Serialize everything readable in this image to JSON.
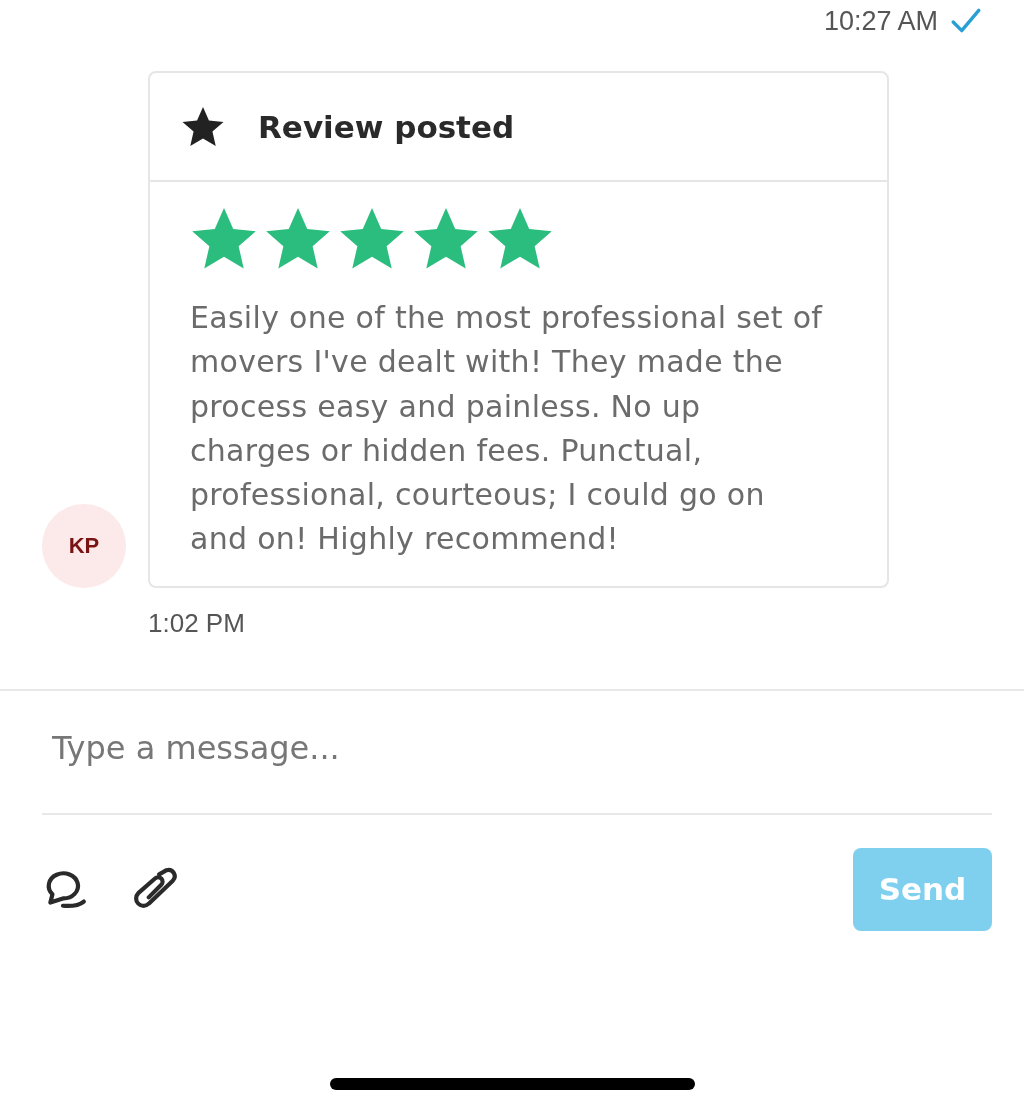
{
  "outgoing_message": {
    "time": "10:27 AM",
    "read": true
  },
  "review_message": {
    "avatar_initials": "KP",
    "title": "Review posted",
    "stars": 5,
    "text": "Easily one of the most professional set of movers I've dealt with! They made the process easy and painless. No up charges or hidden fees. Punctual, professional, courteous; I could go on and on! Highly recommend!",
    "time": "1:02 PM"
  },
  "composer": {
    "placeholder": "Type a message...",
    "send_button": {
      "label": "Send",
      "disabled": true
    }
  }
}
